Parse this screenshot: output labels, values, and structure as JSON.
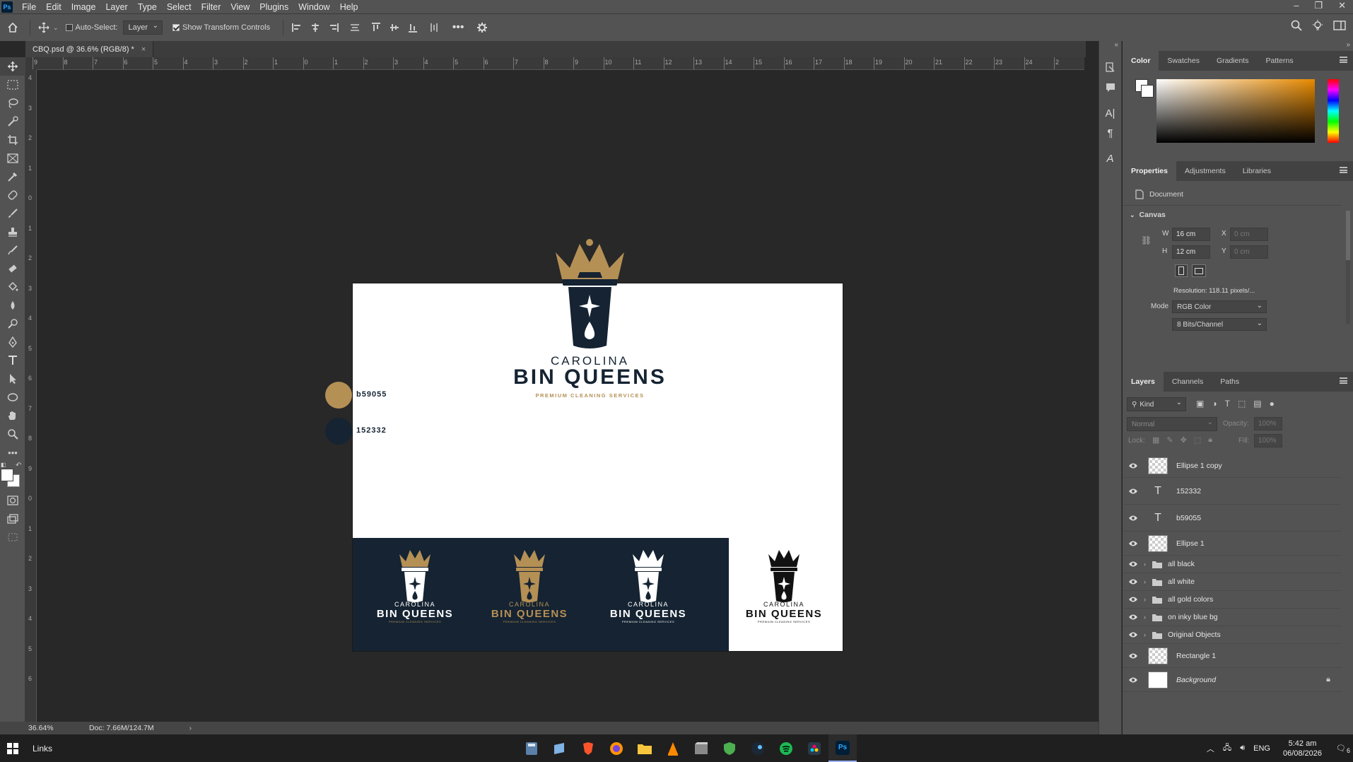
{
  "menu": {
    "items": [
      "File",
      "Edit",
      "Image",
      "Layer",
      "Type",
      "Select",
      "Filter",
      "View",
      "Plugins",
      "Window",
      "Help"
    ]
  },
  "options_bar": {
    "auto_select_label": "Auto-Select:",
    "auto_select_target": "Layer",
    "show_transform_label": "Show Transform Controls"
  },
  "document": {
    "tab_title": "CBQ.psd @ 36.6% (RGB/8) *",
    "brand_line1": "CAROLINA",
    "brand_line2": "BIN QUEENS",
    "tagline": "PREMIUM CLEANING SERVICES",
    "small_tagline": "PREMIUM CLEANING SERVICES",
    "swatches": [
      {
        "hex_label": "b59055",
        "color": "#b59055"
      },
      {
        "hex_label": "152332",
        "color": "#152332"
      }
    ]
  },
  "rulers": {
    "h_ticks": [
      "9",
      "8",
      "7",
      "6",
      "5",
      "4",
      "3",
      "2",
      "1",
      "0",
      "1",
      "2",
      "3",
      "4",
      "5",
      "6",
      "7",
      "8",
      "9",
      "10",
      "11",
      "12",
      "13",
      "14",
      "15",
      "16",
      "17",
      "18",
      "19",
      "20",
      "21",
      "22",
      "23",
      "24",
      "2"
    ],
    "v_ticks": [
      "4",
      "3",
      "2",
      "1",
      "0",
      "1",
      "2",
      "3",
      "4",
      "5",
      "6",
      "7",
      "8",
      "9",
      "0",
      "1",
      "2",
      "3",
      "4",
      "5",
      "6"
    ]
  },
  "status": {
    "zoom": "36.64%",
    "doc_size": "Doc: 7.66M/124.7M"
  },
  "color_panel": {
    "tabs": [
      "Color",
      "Swatches",
      "Gradients",
      "Patterns"
    ],
    "gradient_color": "#e88a00"
  },
  "properties_panel": {
    "tabs": [
      "Properties",
      "Adjustments",
      "Libraries"
    ],
    "document_label": "Document",
    "canvas_label": "Canvas",
    "w_label": "W",
    "w_value": "16 cm",
    "h_label": "H",
    "h_value": "12 cm",
    "x_label": "X",
    "x_placeholder": "0 cm",
    "y_label": "Y",
    "y_placeholder": "0 cm",
    "resolution": "Resolution: 118.11 pixels/...",
    "mode_label": "Mode",
    "mode_value": "RGB Color",
    "depth_value": "8 Bits/Channel"
  },
  "layers_panel": {
    "tabs": [
      "Layers",
      "Channels",
      "Paths"
    ],
    "kind_label": "Kind",
    "blend_mode": "Normal",
    "opacity_label": "Opacity:",
    "opacity_value": "100%",
    "lock_label": "Lock:",
    "fill_label": "Fill:",
    "fill_value": "100%",
    "layers": [
      {
        "name": "Ellipse 1 copy",
        "type": "shape"
      },
      {
        "name": "152332",
        "type": "text"
      },
      {
        "name": "b59055",
        "type": "text"
      },
      {
        "name": "Ellipse 1",
        "type": "shape"
      },
      {
        "name": "all black",
        "type": "group"
      },
      {
        "name": "all white",
        "type": "group"
      },
      {
        "name": "all gold colors",
        "type": "group"
      },
      {
        "name": "on  inky blue bg",
        "type": "group"
      },
      {
        "name": "Original Objects",
        "type": "group"
      },
      {
        "name": "Rectangle 1",
        "type": "shape"
      },
      {
        "name": "Background",
        "type": "background"
      }
    ]
  },
  "taskbar": {
    "links_label": "Links",
    "language": "ENG",
    "time": "5:42 am",
    "date": "06/08/2026",
    "notification_count": "6"
  },
  "colors": {
    "gold": "#b59055",
    "navy": "#152332",
    "ps_blue": "#31a8ff"
  }
}
